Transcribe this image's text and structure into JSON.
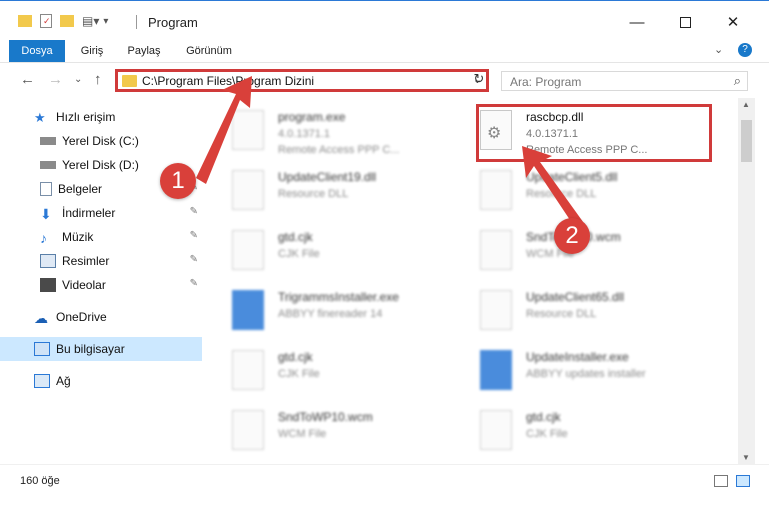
{
  "window": {
    "title": "Program"
  },
  "ribbon": {
    "tabs": [
      "Dosya",
      "Giriş",
      "Paylaş",
      "Görünüm"
    ]
  },
  "address": {
    "path": "C:\\Program Files\\Program Dizini"
  },
  "search": {
    "placeholder": "Ara: Program"
  },
  "sidebar": {
    "items": [
      {
        "label": "Hızlı erişim"
      },
      {
        "label": "Yerel Disk (C:)"
      },
      {
        "label": "Yerel Disk (D:)"
      },
      {
        "label": "Belgeler"
      },
      {
        "label": "İndirmeler"
      },
      {
        "label": "Müzik"
      },
      {
        "label": "Resimler"
      },
      {
        "label": "Videolar"
      },
      {
        "label": "OneDrive"
      },
      {
        "label": "Bu bilgisayar"
      },
      {
        "label": "Ağ"
      }
    ]
  },
  "files": [
    {
      "name": "program.exe",
      "line1": "4.0.1371.1",
      "line2": "Remote Access PPP C..."
    },
    {
      "name": "rascbcp.dll",
      "line1": "4.0.1371.1",
      "line2": "Remote Access PPP C..."
    },
    {
      "name": "UpdateClient19.dll",
      "line1": "Resource DLL",
      "line2": ""
    },
    {
      "name": "UpdateClient5.dll",
      "line1": "Resource DLL",
      "line2": ""
    },
    {
      "name": "gtd.cjk",
      "line1": "CJK File",
      "line2": ""
    },
    {
      "name": "SndToWP10.wcm",
      "line1": "WCM File",
      "line2": ""
    },
    {
      "name": "TrigrammsInstaller.exe",
      "line1": "ABBYY finereader 14",
      "line2": ""
    },
    {
      "name": "UpdateClient65.dll",
      "line1": "Resource DLL",
      "line2": ""
    },
    {
      "name": "gtd.cjk",
      "line1": "CJK File",
      "line2": ""
    },
    {
      "name": "UpdateInstaller.exe",
      "line1": "ABBYY updates installer",
      "line2": ""
    },
    {
      "name": "SndToWP10.wcm",
      "line1": "WCM File",
      "line2": ""
    },
    {
      "name": "gtd.cjk",
      "line1": "CJK File",
      "line2": ""
    }
  ],
  "status": {
    "count": "160 öğe"
  },
  "annotations": {
    "step1": "1",
    "step2": "2"
  },
  "colors": {
    "accent": "#1979ca",
    "highlight": "#d03a3a"
  }
}
